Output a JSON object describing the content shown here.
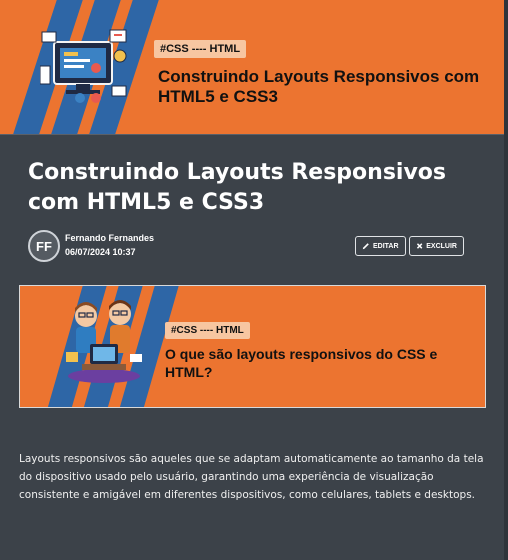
{
  "hero": {
    "tag": "#CSS ---- HTML",
    "title": "Construindo Layouts Responsivos com HTML5 e CSS3"
  },
  "article": {
    "title": "Construindo Layouts Responsivos com HTML5 e CSS3",
    "author": {
      "initials": "FF",
      "name": "Fernando Fernandes",
      "date": "06/07/2024 10:37"
    },
    "actions": {
      "edit_label": "EDITAR",
      "delete_label": "EXCLUIR"
    }
  },
  "inline_banner": {
    "tag": "#CSS ---- HTML",
    "title": "O que são layouts responsivos do CSS e HTML?"
  },
  "body": {
    "paragraph": "Layouts responsivos são aqueles que se adaptam automaticamente ao tamanho da tela do dispositivo usado pelo usuário, garantindo uma experiência de visualização consistente e amigável em diferentes dispositivos, como celulares, tablets e desktops."
  },
  "colors": {
    "background": "#3c4249",
    "banner_orange": "#ec7430",
    "stripe_blue": "#2e66a6",
    "tag_bg": "#f7c6a1"
  },
  "icons": {
    "edit": "pencil-icon",
    "delete": "close-icon"
  }
}
